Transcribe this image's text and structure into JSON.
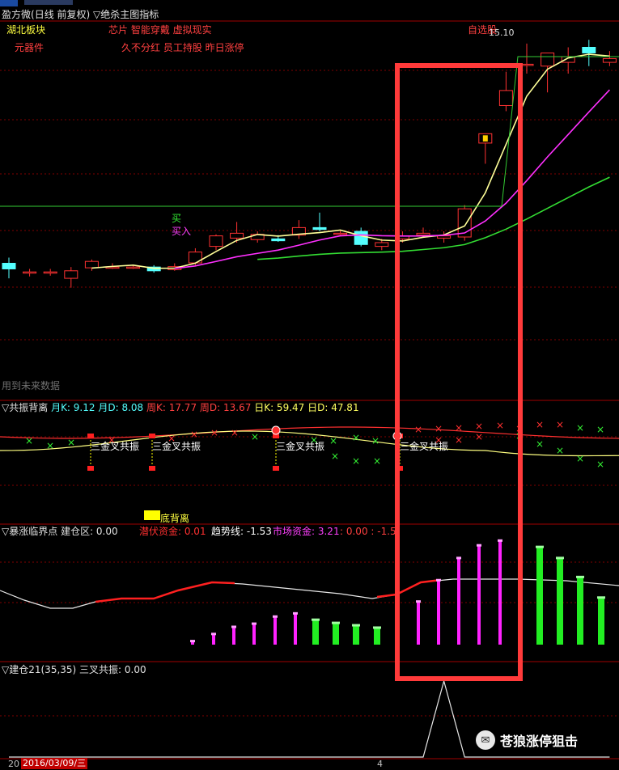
{
  "header": {
    "title_prefix": "盈方微",
    "title_period": "(日线 前复权)",
    "title_indicator": "▽绝杀主图指标",
    "tag_region": "湖北板块",
    "tag_industry": "元器件",
    "concepts_line1": "芯片 智能穿戴 虚拟现实",
    "concepts_line2": "久不分红 员工持股 昨日涨停",
    "tag_zixuan": "自选股",
    "price_high": "15.10",
    "signal_buy": "买",
    "signal_buy2": "买入",
    "future_note": "用到未来数据"
  },
  "panel_resonance": {
    "title": "▽共振背离",
    "yue_k": "月K: 9.12",
    "yue_d": "月D: 8.08",
    "zhou_k": "周K: 17.77",
    "zhou_d": "周D: 13.67",
    "ri_k": "日K: 59.47",
    "ri_d": "日D: 47.81",
    "labels": [
      "三金叉共振",
      "三金叉共振",
      "三金叉共振",
      "三金叉共振"
    ],
    "bottom_div": "底背离"
  },
  "panel_surge": {
    "title": "▽暴涨临界点",
    "jiancang": "建仓区: 0.00",
    "qianfu": "潜伏资金: 0.01",
    "qushi": "趋势线: -1.53",
    "shichang": "市场资金: 3.21",
    "extra": ": 0.00 : -1.5"
  },
  "panel_build": {
    "title": "▽建仓21(35,35)",
    "sancha": "三叉共振: 0.00",
    "date_left": "20",
    "date_cursor": "2016/03/09/三",
    "date_right": "4"
  },
  "watermark": {
    "text": "苍狼涨停狙击",
    "icon": "wechat-icon"
  },
  "colors": {
    "up": "#ff3232",
    "down": "#54ffff",
    "highlight_box": "#ff3a3a",
    "ma_yellow": "#ffff99",
    "ma_magenta": "#ff30ff",
    "ma_green": "#33dd33"
  },
  "chart_data": [
    {
      "type": "candlestick",
      "title": "盈方微(日线 前复权) ▽绝杀主图指标",
      "x": [
        1,
        2,
        3,
        4,
        5,
        6,
        7,
        8,
        9,
        10,
        11,
        12,
        13,
        14,
        15,
        16,
        17,
        18,
        19,
        20,
        21,
        22,
        23,
        24,
        25,
        26,
        27,
        28,
        29,
        30
      ],
      "candles": [
        {
          "o": 9.15,
          "h": 9.3,
          "l": 8.75,
          "c": 9.0
        },
        {
          "o": 8.92,
          "h": 9.0,
          "l": 8.8,
          "c": 8.92
        },
        {
          "o": 8.92,
          "h": 9.0,
          "l": 8.82,
          "c": 8.92
        },
        {
          "o": 8.75,
          "h": 9.05,
          "l": 8.5,
          "c": 8.95
        },
        {
          "o": 9.03,
          "h": 9.25,
          "l": 8.95,
          "c": 9.2
        },
        {
          "o": 9.05,
          "h": 9.15,
          "l": 9.0,
          "c": 9.05
        },
        {
          "o": 9.05,
          "h": 9.1,
          "l": 9.0,
          "c": 9.05
        },
        {
          "o": 9.05,
          "h": 9.1,
          "l": 8.9,
          "c": 8.95
        },
        {
          "o": 8.98,
          "h": 9.15,
          "l": 8.95,
          "c": 9.06
        },
        {
          "o": 9.16,
          "h": 9.55,
          "l": 9.1,
          "c": 9.45
        },
        {
          "o": 9.6,
          "h": 9.92,
          "l": 9.5,
          "c": 9.88
        },
        {
          "o": 9.82,
          "h": 10.25,
          "l": 9.7,
          "c": 9.95
        },
        {
          "o": 9.78,
          "h": 10.0,
          "l": 9.7,
          "c": 9.92
        },
        {
          "o": 9.8,
          "h": 9.9,
          "l": 9.72,
          "c": 9.75
        },
        {
          "o": 9.9,
          "h": 10.3,
          "l": 9.8,
          "c": 10.1
        },
        {
          "o": 10.1,
          "h": 10.5,
          "l": 10.0,
          "c": 10.05
        },
        {
          "o": 9.95,
          "h": 10.02,
          "l": 9.88,
          "c": 9.95
        },
        {
          "o": 10.0,
          "h": 10.1,
          "l": 9.6,
          "c": 9.65
        },
        {
          "o": 9.6,
          "h": 9.8,
          "l": 9.5,
          "c": 9.7
        },
        {
          "o": 9.8,
          "h": 10.0,
          "l": 9.7,
          "c": 9.88
        },
        {
          "o": 9.9,
          "h": 10.1,
          "l": 9.85,
          "c": 9.95
        },
        {
          "o": 9.82,
          "h": 10.0,
          "l": 9.7,
          "c": 9.88
        },
        {
          "o": 9.85,
          "h": 10.7,
          "l": 9.75,
          "c": 10.6
        },
        {
          "o": 12.35,
          "h": 12.45,
          "l": 11.8,
          "c": 12.6
        },
        {
          "o": 13.35,
          "h": 14.25,
          "l": 13.2,
          "c": 13.75
        },
        {
          "o": 14.45,
          "h": 15.0,
          "l": 14.2,
          "c": 14.45
        },
        {
          "o": 14.4,
          "h": 14.7,
          "l": 13.7,
          "c": 14.75
        },
        {
          "o": 14.5,
          "h": 14.9,
          "l": 14.2,
          "c": 14.65
        },
        {
          "o": 14.9,
          "h": 15.1,
          "l": 14.4,
          "c": 14.75
        },
        {
          "o": 14.5,
          "h": 14.8,
          "l": 14.4,
          "c": 14.6
        }
      ],
      "ylim": [
        5.5,
        15.6
      ],
      "price_label": "15.10"
    },
    {
      "type": "line",
      "title": "▽共振背离",
      "series": [
        {
          "name": "月K",
          "value": 9.12
        },
        {
          "name": "月D",
          "value": 8.08
        },
        {
          "name": "周K",
          "value": 17.77
        },
        {
          "name": "周D",
          "value": 13.67
        },
        {
          "name": "日K",
          "value": 59.47
        },
        {
          "name": "日D",
          "value": 47.81
        }
      ]
    },
    {
      "type": "bar",
      "title": "▽暴涨临界点",
      "values": [
        0.5,
        1.4,
        2.3,
        2.7,
        3.6,
        4.0,
        3.2,
        2.8,
        2.5,
        2.2,
        5.5,
        8.2,
        11.0,
        12.6,
        13.2,
        12.4,
        11.0,
        8.6,
        6.0
      ],
      "bar_colors": [
        "m",
        "m",
        "m",
        "m",
        "m",
        "m",
        "g",
        "g",
        "g",
        "g",
        "m",
        "m",
        "m",
        "m",
        "m",
        "g",
        "g",
        "g",
        "g"
      ],
      "ylim": [
        0,
        14
      ]
    },
    {
      "type": "line",
      "title": "▽建仓21(35,35)",
      "values": [
        0,
        0,
        0,
        0,
        0,
        0,
        0,
        0,
        0,
        0,
        0,
        0,
        0,
        0,
        0,
        0,
        0,
        0,
        0,
        0,
        0,
        1,
        0,
        0,
        0,
        0,
        0,
        0,
        0,
        0
      ],
      "ylim": [
        0,
        1
      ]
    }
  ]
}
